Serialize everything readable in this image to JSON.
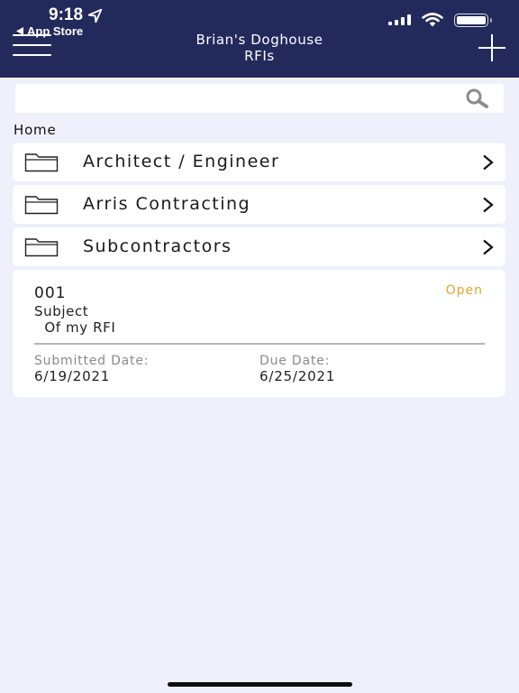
{
  "status_bar": {
    "time": "9:18",
    "back_app": "App Store"
  },
  "header": {
    "project_name": "Brian's Doghouse",
    "title": "RFIs"
  },
  "search": {
    "placeholder": "",
    "value": ""
  },
  "breadcrumb": "Home",
  "folders": [
    {
      "label": "Architect / Engineer"
    },
    {
      "label": "Arris Contracting"
    },
    {
      "label": "Subcontractors"
    }
  ],
  "rfi": {
    "number": "001",
    "status": "Open",
    "subject_label": "Subject",
    "subject": " Of my RFI",
    "submitted_label": "Submitted Date:",
    "submitted_date": "6/19/2021",
    "due_label": "Due Date:",
    "due_date": "6/25/2021"
  },
  "colors": {
    "header_bg": "#222a5c",
    "page_bg": "#eef0fb",
    "status_open": "#e6a52b"
  },
  "icons": [
    "location-arrow-icon",
    "back-triangle-icon",
    "cellular-signal-icon",
    "wifi-icon",
    "battery-icon",
    "hamburger-menu-icon",
    "plus-icon",
    "search-icon",
    "folder-icon",
    "chevron-right-icon"
  ]
}
